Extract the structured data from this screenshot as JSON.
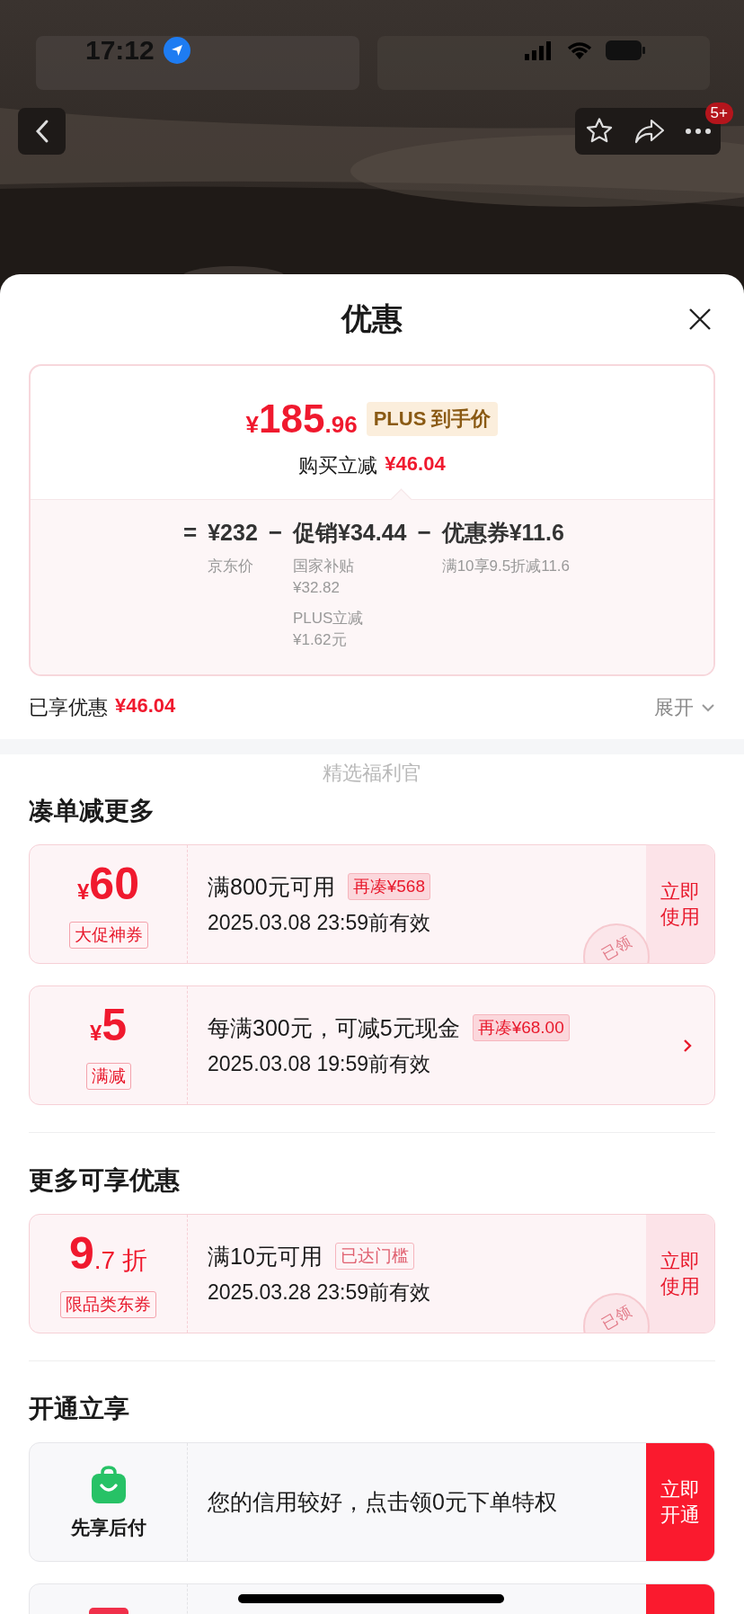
{
  "status_bar": {
    "time": "17:12"
  },
  "top_bar": {
    "badge": "5+"
  },
  "sheet": {
    "title": "优惠",
    "price_card": {
      "currency": "¥",
      "integer": "185",
      "decimal": ".96",
      "badge": "PLUS 到手价",
      "saving_label": "购买立减",
      "saving_amount": "¥46.04",
      "terms": [
        {
          "operator": "=",
          "value": "¥232",
          "notes": [
            {
              "label": "京东价"
            }
          ]
        },
        {
          "operator": "−",
          "value": "促销¥34.44",
          "notes": [
            {
              "label": "国家补贴",
              "amount": "¥32.82"
            },
            {
              "label": "PLUS立减",
              "amount": "¥1.62元"
            }
          ]
        },
        {
          "operator": "−",
          "value": "优惠券¥11.6",
          "notes": [
            {
              "label": "满10享9.5折减11.6"
            }
          ]
        }
      ]
    },
    "enjoyed": {
      "label": "已享优惠",
      "amount": "¥46.04",
      "toggle": "展开",
      "expanded": false
    },
    "watermark_caption": "精选福利官",
    "sections": [
      {
        "title": "凑单减更多",
        "items": [
          {
            "kind": "coupon",
            "prefix": "¥",
            "big": "60",
            "tag": "大促神券",
            "title": "满800元可用",
            "chip": {
              "text": "再凑¥568",
              "reached": false
            },
            "validity": "2025.03.08 23:59前有效",
            "action": "立即使用",
            "stamp": "已领"
          },
          {
            "kind": "promo",
            "prefix": "¥",
            "big": "5",
            "tag": "满减",
            "title": "每满300元，可减5元现金",
            "chip": {
              "text": "再凑¥68.00",
              "reached": false
            },
            "validity": "2025.03.08 19:59前有效"
          }
        ]
      },
      {
        "title": "更多可享优惠",
        "items": [
          {
            "kind": "coupon",
            "big": "9",
            "small": ".7 折",
            "tag": "限品类东券",
            "title": "满10元可用",
            "chip": {
              "text": "已达门槛",
              "reached": true
            },
            "validity": "2025.03.28 23:59前有效",
            "action": "立即使用",
            "stamp": "已领"
          }
        ]
      },
      {
        "title": "开通立享",
        "items": [
          {
            "kind": "service",
            "name": "先享后付",
            "title": "您的信用较好，点击领0元下单特权",
            "action": "立即开通"
          },
          {
            "kind": "service_peek"
          }
        ]
      }
    ]
  }
}
